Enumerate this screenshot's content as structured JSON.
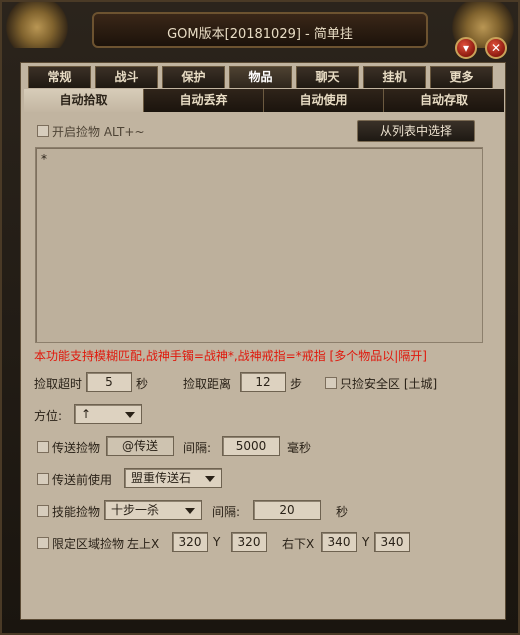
{
  "window": {
    "title": "GOM版本[20181029] - 简单挂",
    "minimize_icon": "chevron-down-icon",
    "close_icon": "close-icon"
  },
  "main_tabs": [
    "常规",
    "战斗",
    "保护",
    "物品",
    "聊天",
    "挂机",
    "更多"
  ],
  "active_main_tab": "物品",
  "sub_tabs": [
    "自动拾取",
    "自动丢弃",
    "自动使用",
    "自动存取"
  ],
  "active_sub_tab": "自动拾取",
  "pickup": {
    "enable_label": "开启捡物 ALT+~",
    "enabled": false,
    "choose_button": "从列表中选择",
    "list_text": "*",
    "note": "本功能支持模糊匹配,战神手镯=战神*,战神戒指=*戒指 [多个物品以|隔开]",
    "timeout_label": "捡取超时",
    "timeout_value": "5",
    "timeout_unit": "秒",
    "distance_label": "捡取距离",
    "distance_value": "12",
    "distance_unit": "步",
    "safe_zone_label": "只捡安全区 [土城]",
    "direction_label": "方位:",
    "direction_value": "↑",
    "teleport_pick_label": "传送捡物",
    "teleport_command": "@传送",
    "teleport_interval_label": "间隔:",
    "teleport_interval_value": "5000",
    "teleport_interval_unit": "毫秒",
    "before_teleport_label": "传送前使用",
    "before_teleport_item": "盟重传送石",
    "skill_pick_label": "技能捡物",
    "skill_value": "十步一杀",
    "skill_interval_label": "间隔:",
    "skill_interval_value": "20",
    "skill_interval_unit": "秒",
    "area_label": "限定区域捡物",
    "top_left_label": "左上X",
    "top_left_x": "320",
    "top_left_y_label": "Y",
    "top_left_y": "320",
    "bottom_right_label": "右下X",
    "bottom_right_x": "340",
    "bottom_right_y_label": "Y",
    "bottom_right_y": "340"
  }
}
